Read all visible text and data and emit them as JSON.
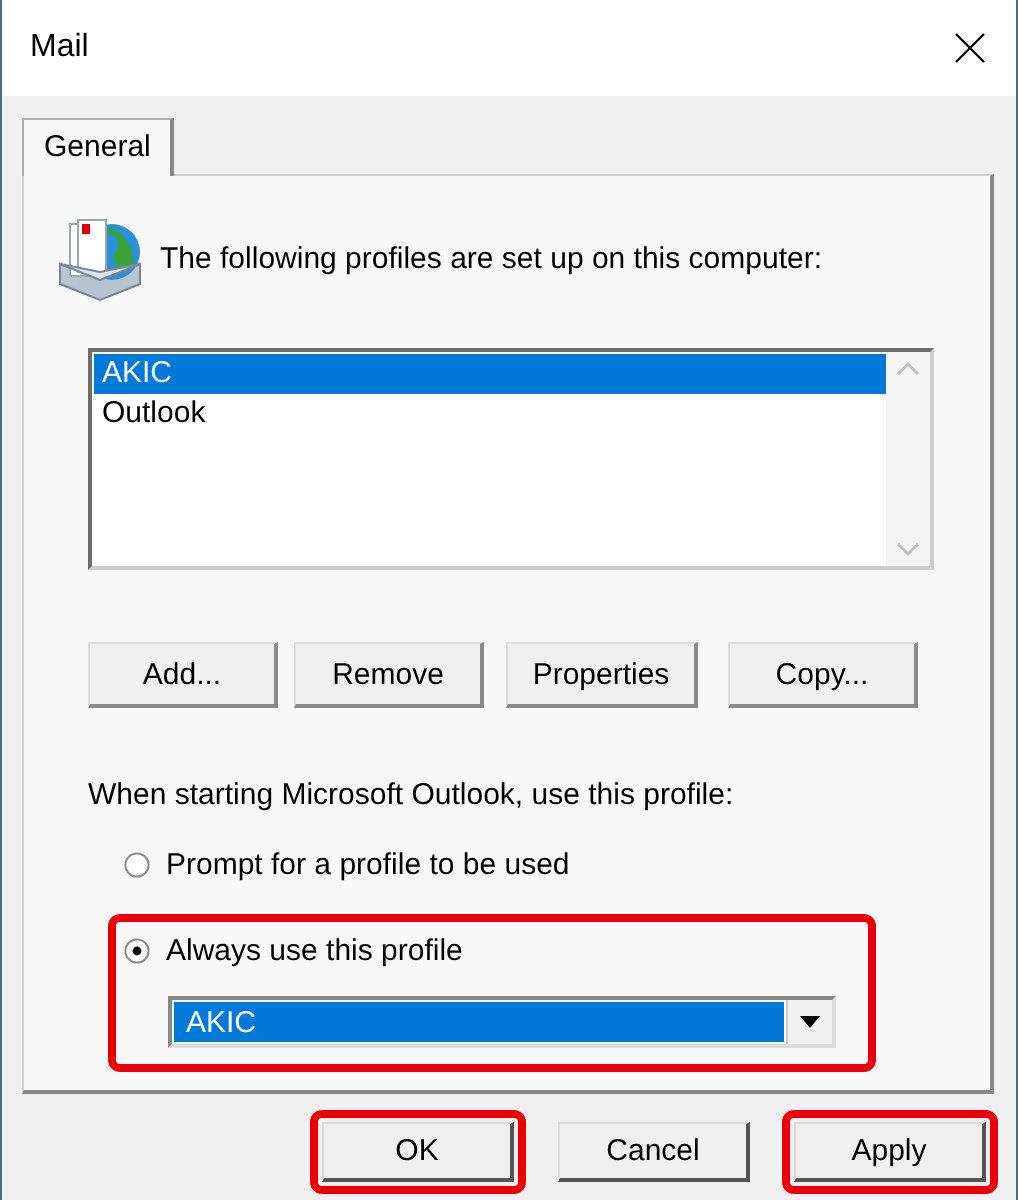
{
  "window": {
    "title": "Mail"
  },
  "tabs": [
    {
      "label": "General",
      "selected": true
    }
  ],
  "header": {
    "text": "The following profiles are set up on this computer:"
  },
  "profiles": [
    {
      "name": "AKIC",
      "selected": true
    },
    {
      "name": "Outlook",
      "selected": false
    }
  ],
  "profile_buttons": [
    "Add...",
    "Remove",
    "Properties",
    "Copy..."
  ],
  "startup": {
    "label": "When starting Microsoft Outlook, use this profile:",
    "options": [
      {
        "label": "Prompt for a profile to be used",
        "selected": false,
        "highlighted": false
      },
      {
        "label": "Always use this profile",
        "selected": true,
        "highlighted": true,
        "dropdown": {
          "value": "AKIC"
        }
      }
    ]
  },
  "buttons": [
    {
      "label": "OK",
      "highlighted": true
    },
    {
      "label": "Cancel",
      "highlighted": false
    },
    {
      "label": "Apply",
      "highlighted": true
    }
  ]
}
